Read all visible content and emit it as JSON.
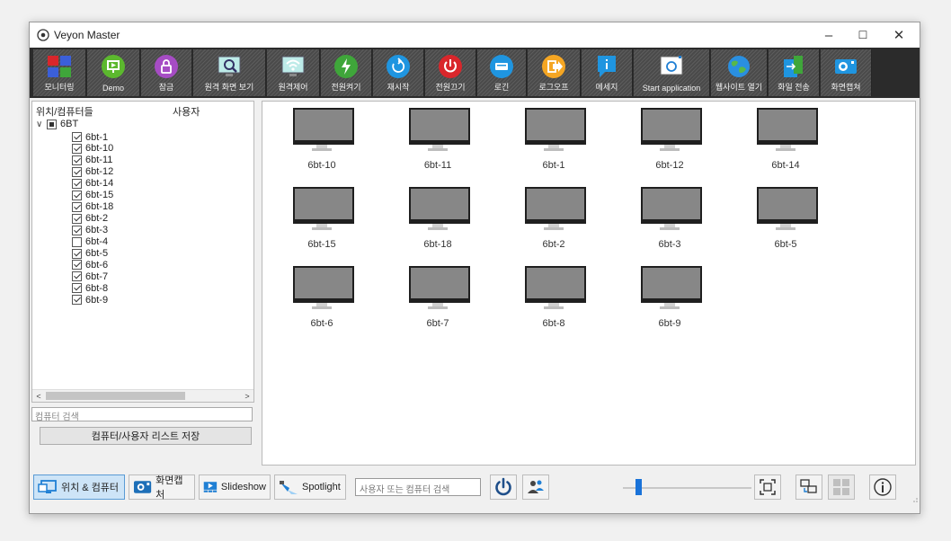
{
  "window": {
    "title": "Veyon Master",
    "controls": {
      "minimize": "–",
      "maximize": "☐",
      "close": "✕"
    }
  },
  "toolbar": {
    "items": [
      {
        "label": "모니터링",
        "icon": "monitoring-icon"
      },
      {
        "label": "Demo",
        "icon": "demo-icon",
        "color": "#5cb82e"
      },
      {
        "label": "잠금",
        "icon": "lock-icon",
        "color": "#a64cc4"
      },
      {
        "label": "원격 화면 보기",
        "icon": "remote-view-icon"
      },
      {
        "label": "원격제어",
        "icon": "remote-control-icon"
      },
      {
        "label": "전원켜기",
        "icon": "power-on-icon",
        "color": "#3fa63a"
      },
      {
        "label": "재시작",
        "icon": "reboot-icon",
        "color": "#1f95e0"
      },
      {
        "label": "전원끄기",
        "icon": "power-off-icon",
        "color": "#d9262b"
      },
      {
        "label": "로긴",
        "icon": "login-icon",
        "color": "#1f95e0"
      },
      {
        "label": "로그오프",
        "icon": "logoff-icon",
        "color": "#f5a623"
      },
      {
        "label": "메세지",
        "icon": "message-icon",
        "color": "#1f95e0"
      },
      {
        "label": "Start application",
        "icon": "start-application-icon"
      },
      {
        "label": "웹사이트 열기",
        "icon": "open-website-icon"
      },
      {
        "label": "화일 전송",
        "icon": "file-transfer-icon"
      },
      {
        "label": "화면캡쳐",
        "icon": "screenshot-icon"
      }
    ]
  },
  "tree": {
    "header_location": "위치/컴퓨터들",
    "header_user": "사용자",
    "root": {
      "label": "6BT",
      "state": "partial"
    },
    "items": [
      {
        "label": "6bt-1",
        "checked": true
      },
      {
        "label": "6bt-10",
        "checked": true
      },
      {
        "label": "6bt-11",
        "checked": true
      },
      {
        "label": "6bt-12",
        "checked": true
      },
      {
        "label": "6bt-14",
        "checked": true
      },
      {
        "label": "6bt-15",
        "checked": true
      },
      {
        "label": "6bt-18",
        "checked": true
      },
      {
        "label": "6bt-2",
        "checked": true
      },
      {
        "label": "6bt-3",
        "checked": true
      },
      {
        "label": "6bt-4",
        "checked": false
      },
      {
        "label": "6bt-5",
        "checked": true
      },
      {
        "label": "6bt-6",
        "checked": true
      },
      {
        "label": "6bt-7",
        "checked": true
      },
      {
        "label": "6bt-8",
        "checked": true
      },
      {
        "label": "6bt-9",
        "checked": true
      }
    ],
    "search_placeholder": "컴퓨터 검색",
    "save_button": "컴퓨터/사용자 리스트 저장"
  },
  "computers": [
    "6bt-10",
    "6bt-11",
    "6bt-1",
    "6bt-12",
    "6bt-14",
    "6bt-15",
    "6bt-18",
    "6bt-2",
    "6bt-3",
    "6bt-5",
    "6bt-6",
    "6bt-7",
    "6bt-8",
    "6bt-9"
  ],
  "statusbar": {
    "location_button": "위치 & 컴퓨터",
    "screenshot_button": "화면캡처",
    "slideshow_button": "Slideshow",
    "spotlight_button": "Spotlight",
    "search_placeholder": "사용자 또는 컴퓨터 검색",
    "zoom_level": 0.1
  }
}
